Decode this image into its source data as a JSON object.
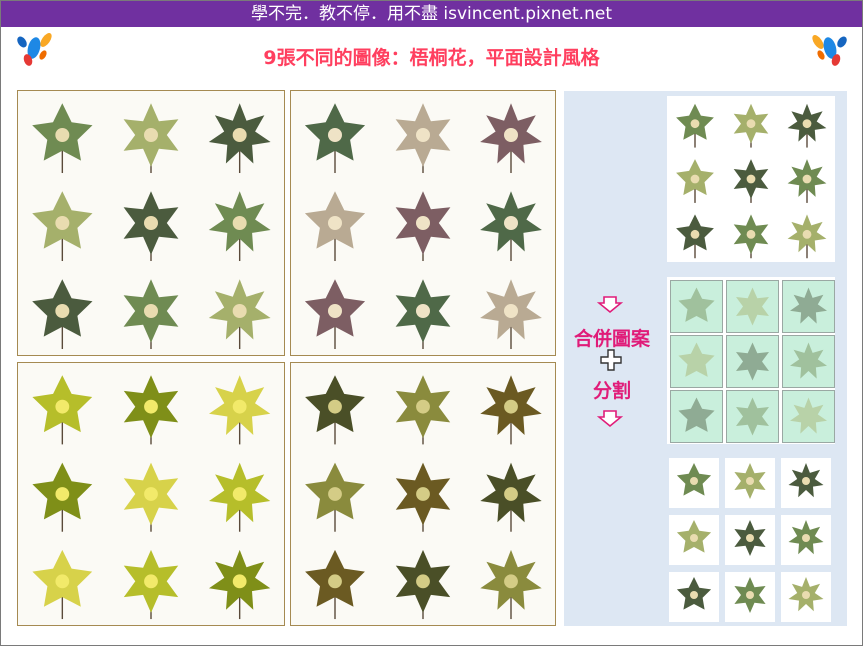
{
  "header": {
    "banner_text": "學不完．教不停．用不盡 isvincent.pixnet.net",
    "subtitle": "9張不同的圖像：梧桐花，平面設計風格"
  },
  "panels": [
    {
      "name": "panel-top-left",
      "palette": [
        "#6f8b52",
        "#a5b06b",
        "#4b5b3e"
      ],
      "bloom": "#e9dcb0"
    },
    {
      "name": "panel-top-right",
      "palette": [
        "#4f6948",
        "#b9aa93",
        "#7d5e63"
      ],
      "bloom": "#efe3c6"
    },
    {
      "name": "panel-bottom-left",
      "palette": [
        "#b6be2a",
        "#7f8f18",
        "#d7d24a"
      ],
      "bloom": "#f2ea6a"
    },
    {
      "name": "panel-bottom-right",
      "palette": [
        "#4a4f27",
        "#8a8b3d",
        "#6b5a22"
      ],
      "bloom": "#d4cc86"
    }
  ],
  "process": {
    "merge_label": "合併圖案",
    "split_label": "分割",
    "arrow_icon": "down-arrow-icon",
    "plus_icon": "plus-icon"
  },
  "colors": {
    "banner": "#7030a0",
    "subtitle": "#ff3f5f",
    "accent": "#e01c79",
    "side_panel": "#dde7f3",
    "tile_fill": "#c9efdc",
    "panel_border": "#a58a52"
  }
}
